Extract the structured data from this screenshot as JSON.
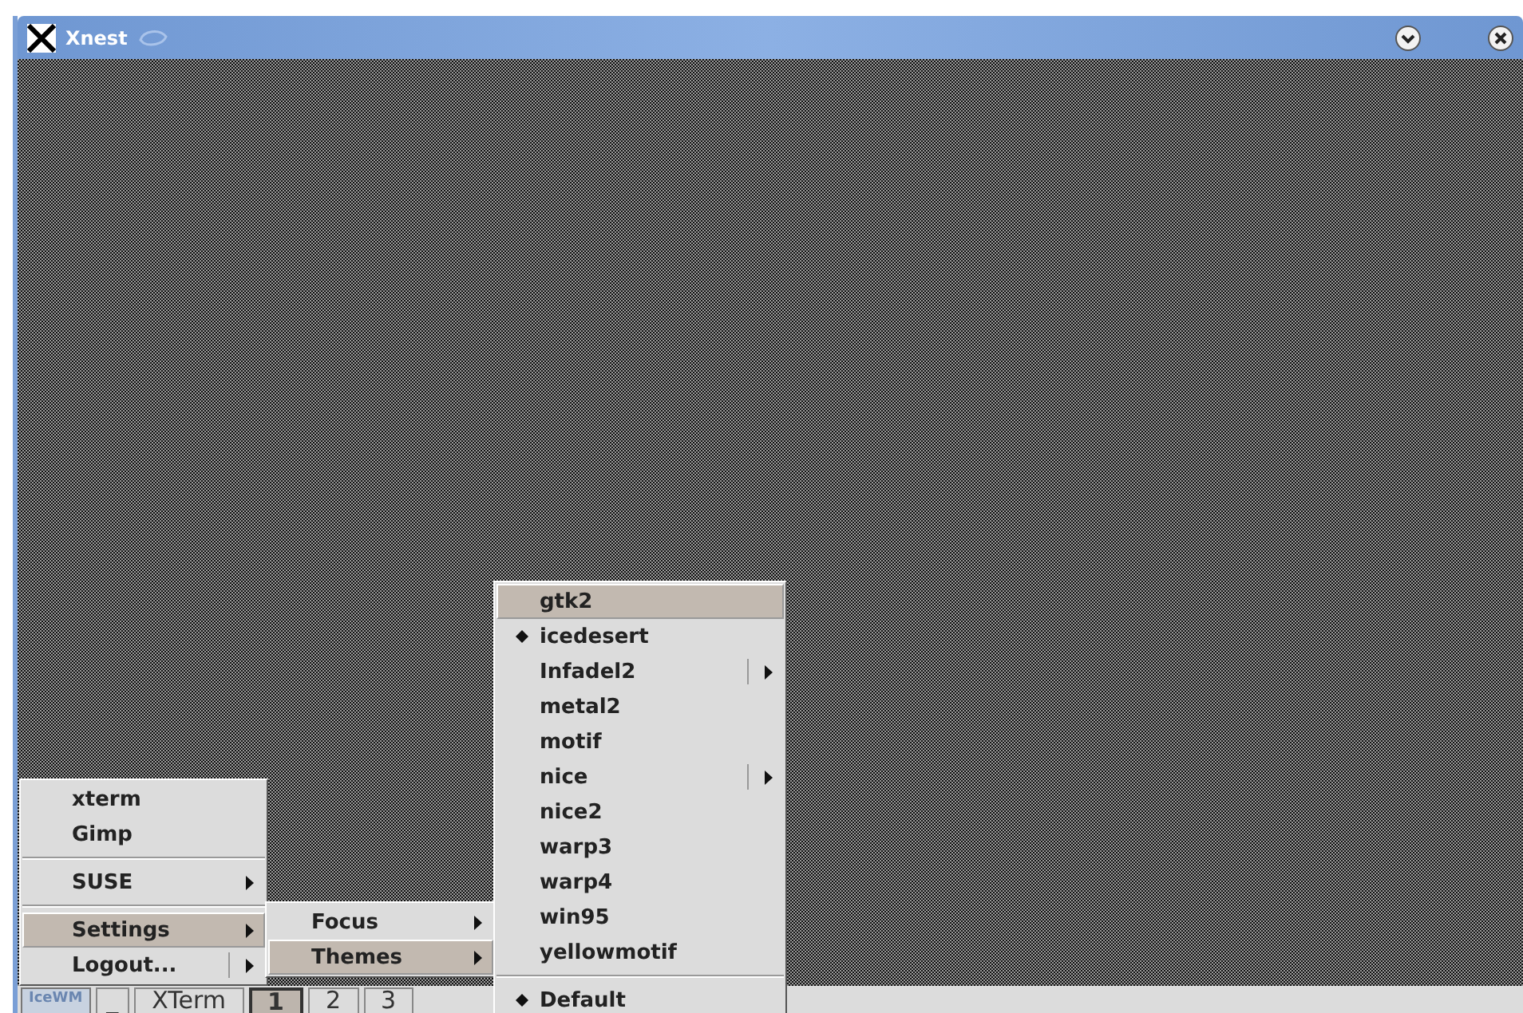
{
  "window": {
    "title": "Xnest"
  },
  "main_menu": {
    "items": [
      {
        "kind": "item",
        "label": "xterm",
        "selected": false,
        "submenu": false
      },
      {
        "kind": "item",
        "label": "Gimp",
        "selected": false,
        "submenu": false
      },
      {
        "kind": "separator"
      },
      {
        "kind": "item",
        "label": "SUSE",
        "selected": false,
        "submenu": true
      },
      {
        "kind": "separator"
      },
      {
        "kind": "item",
        "label": "Settings",
        "selected": true,
        "submenu": true
      },
      {
        "kind": "item",
        "label": "Logout...",
        "selected": false,
        "submenu": true,
        "split": true
      }
    ]
  },
  "settings_menu": {
    "items": [
      {
        "kind": "item",
        "label": "Focus",
        "selected": false,
        "submenu": true
      },
      {
        "kind": "item",
        "label": "Themes",
        "selected": true,
        "submenu": true
      }
    ]
  },
  "themes_menu": {
    "items": [
      {
        "kind": "item",
        "label": "gtk2",
        "selected": true,
        "checked": false,
        "submenu": false
      },
      {
        "kind": "item",
        "label": "icedesert",
        "selected": false,
        "checked": true,
        "submenu": false
      },
      {
        "kind": "item",
        "label": "Infadel2",
        "selected": false,
        "checked": false,
        "submenu": true,
        "split": true
      },
      {
        "kind": "item",
        "label": "metal2",
        "selected": false,
        "checked": false,
        "submenu": false
      },
      {
        "kind": "item",
        "label": "motif",
        "selected": false,
        "checked": false,
        "submenu": false
      },
      {
        "kind": "item",
        "label": "nice",
        "selected": false,
        "checked": false,
        "submenu": true,
        "split": true
      },
      {
        "kind": "item",
        "label": "nice2",
        "selected": false,
        "checked": false,
        "submenu": false
      },
      {
        "kind": "item",
        "label": "warp3",
        "selected": false,
        "checked": false,
        "submenu": false
      },
      {
        "kind": "item",
        "label": "warp4",
        "selected": false,
        "checked": false,
        "submenu": false
      },
      {
        "kind": "item",
        "label": "win95",
        "selected": false,
        "checked": false,
        "submenu": false
      },
      {
        "kind": "item",
        "label": "yellowmotif",
        "selected": false,
        "checked": false,
        "submenu": false
      },
      {
        "kind": "separator"
      },
      {
        "kind": "item",
        "label": "Default",
        "selected": false,
        "checked": true,
        "submenu": false
      }
    ]
  },
  "taskbar": {
    "logo": "IceWM",
    "minimize": "_",
    "tasks": [
      {
        "label": "XTerm"
      }
    ],
    "workspaces": [
      {
        "label": "1",
        "selected": true
      },
      {
        "label": "2",
        "selected": false
      },
      {
        "label": "3",
        "selected": false
      }
    ]
  }
}
